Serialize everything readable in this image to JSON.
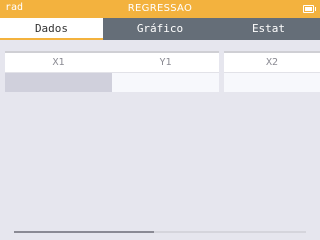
{
  "status_bar": {
    "left_text": "rad",
    "title": "REGRESSAO",
    "battery_icon": "battery-icon"
  },
  "tabs": [
    {
      "label": "Dados",
      "selected": true
    },
    {
      "label": "Gráfico",
      "selected": false
    },
    {
      "label": "Estat",
      "selected": false
    }
  ],
  "tables": [
    {
      "columns": [
        "X1",
        "Y1"
      ],
      "rows": [
        [
          "",
          ""
        ]
      ]
    },
    {
      "columns": [
        "X2"
      ],
      "rows": [
        [
          ""
        ]
      ]
    }
  ],
  "selected_cell": {
    "table": 1,
    "column": "X1",
    "row": 1
  },
  "horizontal_scroll": {
    "position_fraction": 0.0,
    "visible_fraction": 0.48
  },
  "colors": {
    "accent": "#f3b23e",
    "tab_bar": "#656e78",
    "background": "#e6e6ee",
    "selected_cell": "#d0d0dc"
  }
}
